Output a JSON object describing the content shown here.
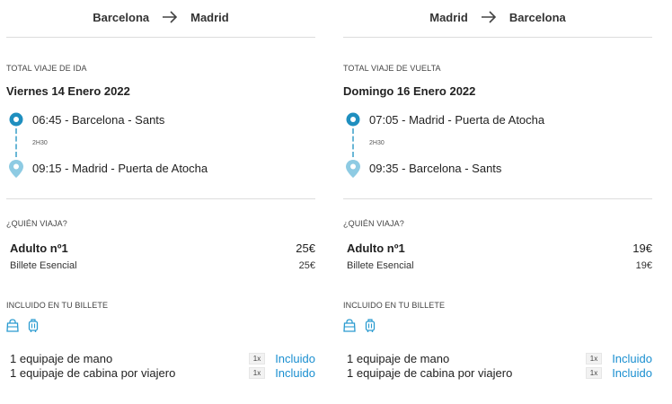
{
  "colors": {
    "accent": "#1a8fd0",
    "pin_origin": "#1f8fbf",
    "pin_dest": "#8ecbe3",
    "divider": "#dcdcdc"
  },
  "icons": {
    "route_arrow": "arrow-right-icon",
    "origin": "origin-marker-icon",
    "destination": "destination-pin-icon",
    "bag_hand": "handbag-icon",
    "bag_cabin": "cabin-suitcase-icon"
  },
  "outbound": {
    "route_from": "Barcelona",
    "route_to": "Madrid",
    "total_label": "TOTAL VIAJE DE IDA",
    "date": "Viernes 14 Enero 2022",
    "depart": "06:45 - Barcelona - Sants",
    "duration": "2H30",
    "arrive": "09:15 - Madrid - Puerta de Atocha",
    "who_label": "¿QUIÉN VIAJA?",
    "passenger": "Adulto nº1",
    "passenger_price": "25€",
    "fare": "Billete Esencial",
    "fare_price": "25€",
    "included_label": "INCLUIDO EN TU BILLETE",
    "items": [
      {
        "name": "1 equipaje de mano",
        "qty": "1x",
        "status": "Incluido"
      },
      {
        "name": "1 equipaje de cabina por viajero",
        "qty": "1x",
        "status": "Incluido"
      }
    ]
  },
  "return": {
    "route_from": "Madrid",
    "route_to": "Barcelona",
    "total_label": "TOTAL VIAJE DE VUELTA",
    "date": "Domingo 16 Enero 2022",
    "depart": "07:05 - Madrid - Puerta de Atocha",
    "duration": "2H30",
    "arrive": "09:35 - Barcelona - Sants",
    "who_label": "¿QUIÉN VIAJA?",
    "passenger": "Adulto nº1",
    "passenger_price": "19€",
    "fare": "Billete Esencial",
    "fare_price": "19€",
    "included_label": "INCLUIDO EN TU BILLETE",
    "items": [
      {
        "name": "1 equipaje de mano",
        "qty": "1x",
        "status": "Incluido"
      },
      {
        "name": "1 equipaje de cabina por viajero",
        "qty": "1x",
        "status": "Incluido"
      }
    ]
  }
}
